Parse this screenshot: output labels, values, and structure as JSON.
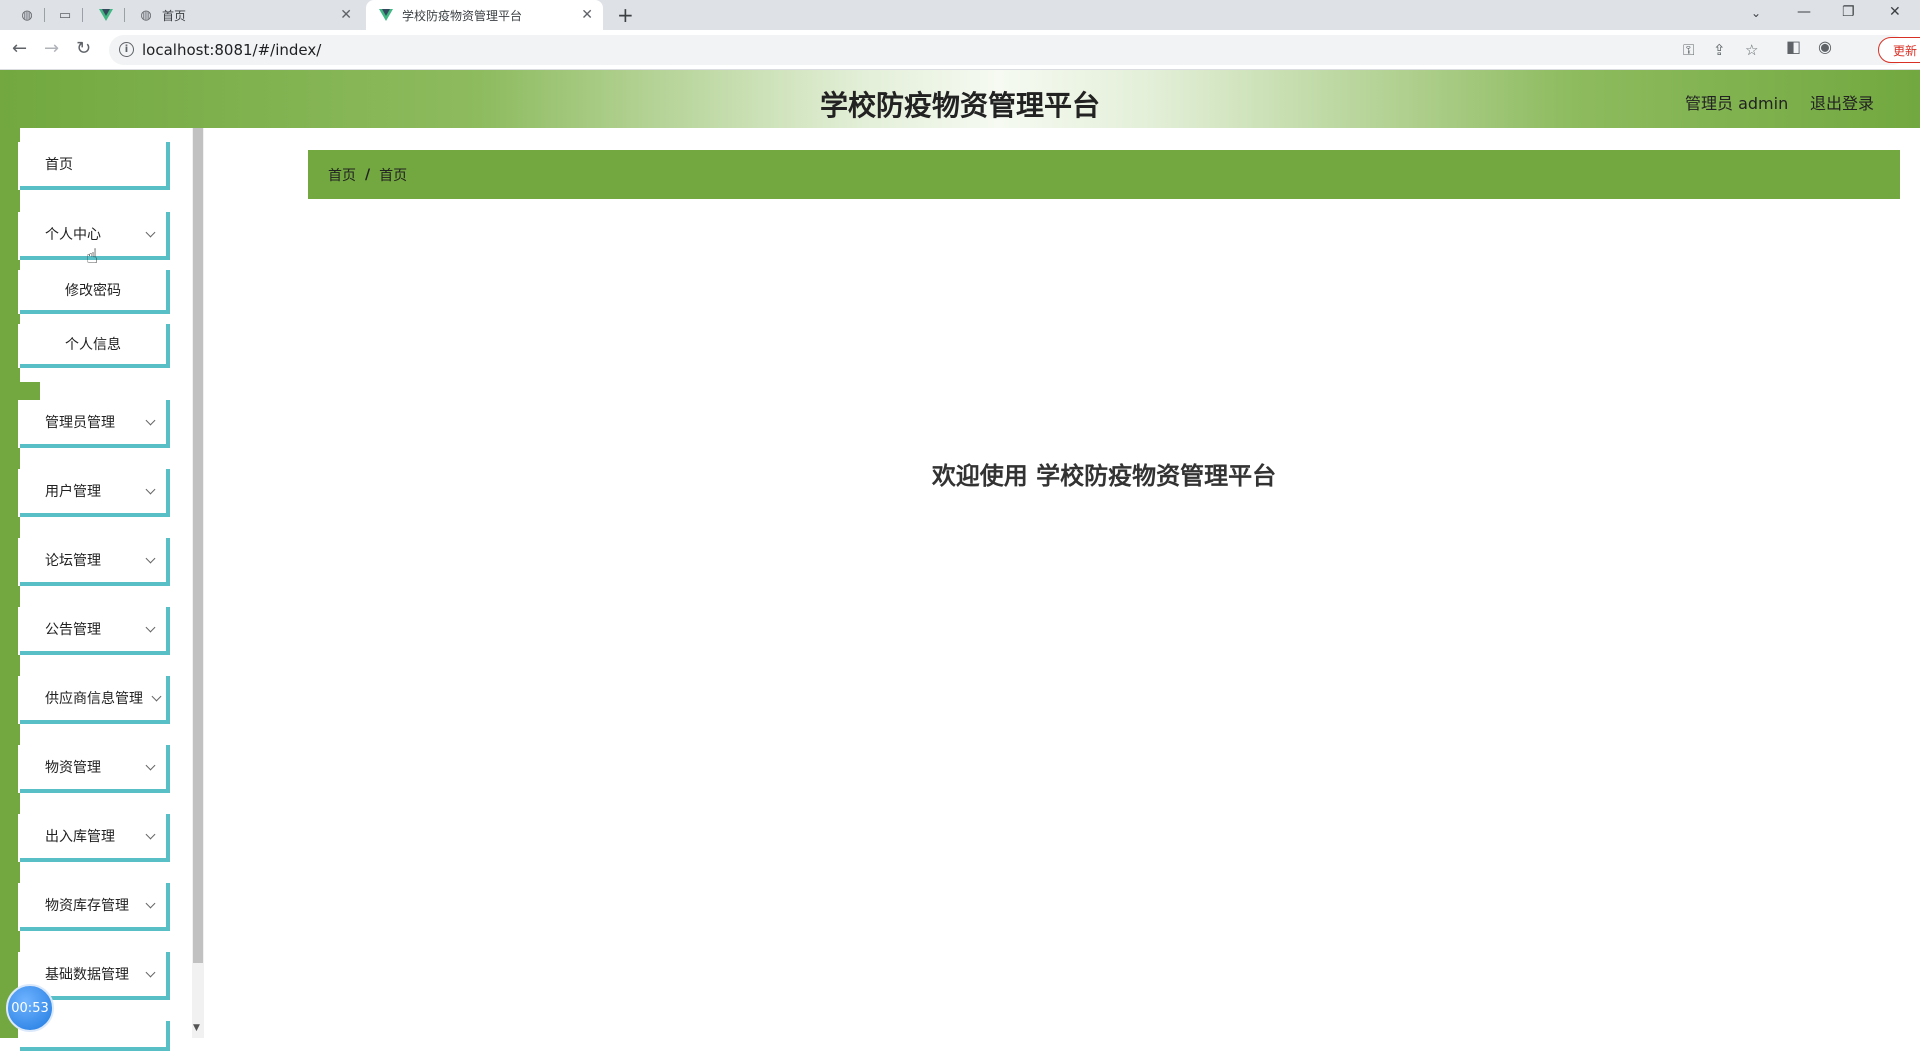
{
  "browser": {
    "tabs": [
      {
        "label": "首页",
        "active": false
      },
      {
        "label": "学校防疫物资管理平台",
        "active": true
      }
    ],
    "url": "localhost:8081/#/index/",
    "update_label": "更新"
  },
  "header": {
    "title": "学校防疫物资管理平台",
    "user_role": "管理员 admin",
    "logout_label": "退出登录"
  },
  "sidebar": {
    "items": [
      {
        "label": "首页"
      },
      {
        "label": "个人中心",
        "expanded": true,
        "children": [
          {
            "label": "修改密码"
          },
          {
            "label": "个人信息"
          }
        ]
      },
      {
        "label": "管理员管理"
      },
      {
        "label": "用户管理"
      },
      {
        "label": "论坛管理"
      },
      {
        "label": "公告管理"
      },
      {
        "label": "供应商信息管理"
      },
      {
        "label": "物资管理"
      },
      {
        "label": "出入库管理"
      },
      {
        "label": "物资库存管理"
      },
      {
        "label": "基础数据管理"
      }
    ]
  },
  "breadcrumb": [
    "首页",
    "首页"
  ],
  "main": {
    "welcome": "欢迎使用 学校防疫物资管理平台"
  },
  "timer": "00:53",
  "colors": {
    "accent_green": "#72a83f",
    "menu_border": "#58bfc7"
  }
}
